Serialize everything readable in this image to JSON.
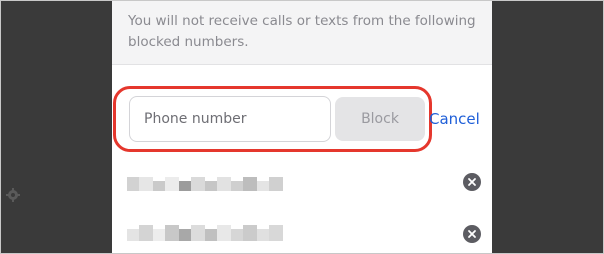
{
  "dialog": {
    "info_text": "You will not receive calls or texts from the following blocked numbers."
  },
  "form": {
    "phone_placeholder": "Phone number",
    "block_label": "Block",
    "cancel_label": "Cancel"
  },
  "blocked_numbers": [
    {
      "number": "",
      "remove_icon": "close-circle-icon"
    },
    {
      "number": "",
      "remove_icon": "close-circle-icon"
    }
  ],
  "colors": {
    "highlight": "#e5372d",
    "link": "#1f5fd8"
  }
}
